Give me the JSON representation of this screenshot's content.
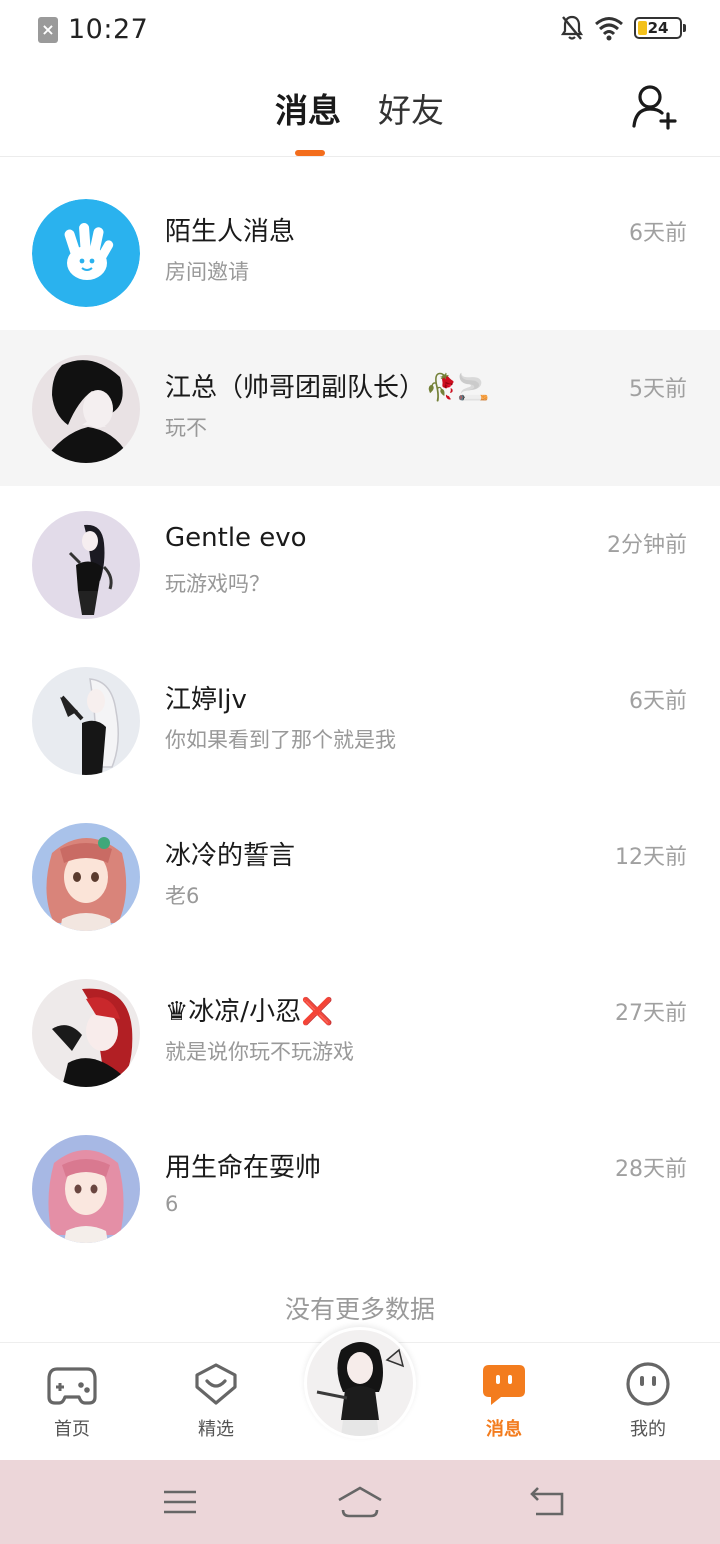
{
  "status_bar": {
    "time": "10:27",
    "battery_level": "24"
  },
  "header": {
    "tabs": [
      {
        "label": "消息",
        "active": true
      },
      {
        "label": "好友",
        "active": false
      }
    ],
    "add_friend_icon": "add-user-icon",
    "accent": "#f36d1c"
  },
  "messages": [
    {
      "name": "陌生人消息",
      "preview": "房间邀请",
      "time": "6天前",
      "highlighted": false
    },
    {
      "name": "江总（帅哥团副队长）🥀🚬",
      "preview": "玩不",
      "time": "5天前",
      "highlighted": true
    },
    {
      "name": "Gentle evo",
      "preview": "玩游戏吗？",
      "time": "2分钟前",
      "highlighted": false
    },
    {
      "name": "江婷ljv",
      "preview": "你如果看到了那个就是我",
      "time": "6天前",
      "highlighted": false
    },
    {
      "name": "冰冷的誓言",
      "preview": "老6",
      "time": "12天前",
      "highlighted": false
    },
    {
      "name": "♛冰凉/小忍❌",
      "preview": "就是说你玩不玩游戏",
      "time": "27天前",
      "highlighted": false
    },
    {
      "name": "用生命在耍帅",
      "preview": "6",
      "time": "28天前",
      "highlighted": false
    }
  ],
  "list_footer": "没有更多数据",
  "bottom_nav": {
    "items": [
      {
        "label": "首页",
        "icon": "gamepad-icon",
        "active": false
      },
      {
        "label": "精选",
        "icon": "heart-badge-icon",
        "active": false
      },
      {
        "label": "消息",
        "icon": "chat-bubble-icon",
        "active": true
      },
      {
        "label": "我的",
        "icon": "smiley-face-icon",
        "active": false
      }
    ],
    "active_color": "#f37c1e"
  }
}
